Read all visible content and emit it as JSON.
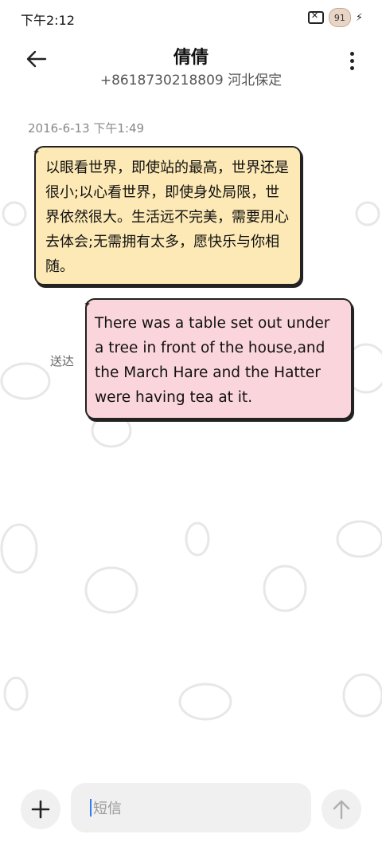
{
  "status_bar": {
    "time": "下午2:12",
    "battery_level": "91"
  },
  "header": {
    "contact_name": "倩倩",
    "contact_subtitle": "+8618730218809 河北保定"
  },
  "conversation": {
    "timestamp": "2016-6-13 下午1:49",
    "messages": [
      {
        "direction": "incoming",
        "text": "以眼看世界，即使站的最高，世界还是很小;以心看世界，即使身处局限，世界依然很大。生活远不完美，需要用心去体会;无需拥有太多，愿快乐与你相随。"
      },
      {
        "direction": "outgoing",
        "text": "There was a table set out under a tree in front of the house,and the March Hare and the Hatter were having tea at it."
      }
    ],
    "delivery_status": "送达"
  },
  "composer": {
    "placeholder": "短信"
  },
  "colors": {
    "incoming_bubble": "#fde9b5",
    "outgoing_bubble": "#fbd5dc",
    "caret": "#2f7cf6"
  },
  "icons": {
    "back": "arrow-left-icon",
    "more": "more-vertical-icon",
    "add": "plus-icon",
    "send": "arrow-up-icon"
  }
}
